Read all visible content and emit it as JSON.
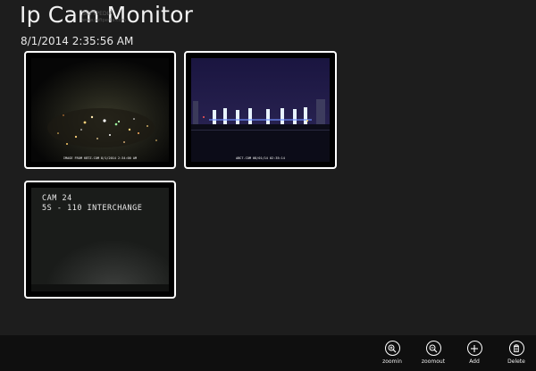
{
  "app": {
    "title": "Ip Cam Monitor",
    "datetime": "8/1/2014 2:35:56 AM",
    "watermark": "SOFTPEDIA",
    "watermark_url": "www.softpedia.com"
  },
  "cameras": [
    {
      "caption": "IMAGE FROM KBTZ.COM 8/1/2014 2:34:00 AM"
    },
    {
      "caption": "ABC7.COM 08/01/14 02:35:14"
    },
    {
      "overlay_line1": "CAM 24",
      "overlay_line2": "5S - 110 INTERCHANGE"
    }
  ],
  "appbar": {
    "zoomin_label": "zoomin",
    "zoomout_label": "zoomout",
    "add_label": "Add",
    "delete_label": "Delete"
  },
  "icons": {
    "zoomin": "zoom-in-magnifier",
    "zoomout": "zoom-out-magnifier",
    "add": "plus",
    "delete": "trash-can"
  },
  "colors": {
    "background": "#1d1d1d",
    "appbar": "#0f0f0f",
    "tile_border": "#ffffff",
    "text": "#ffffff"
  }
}
